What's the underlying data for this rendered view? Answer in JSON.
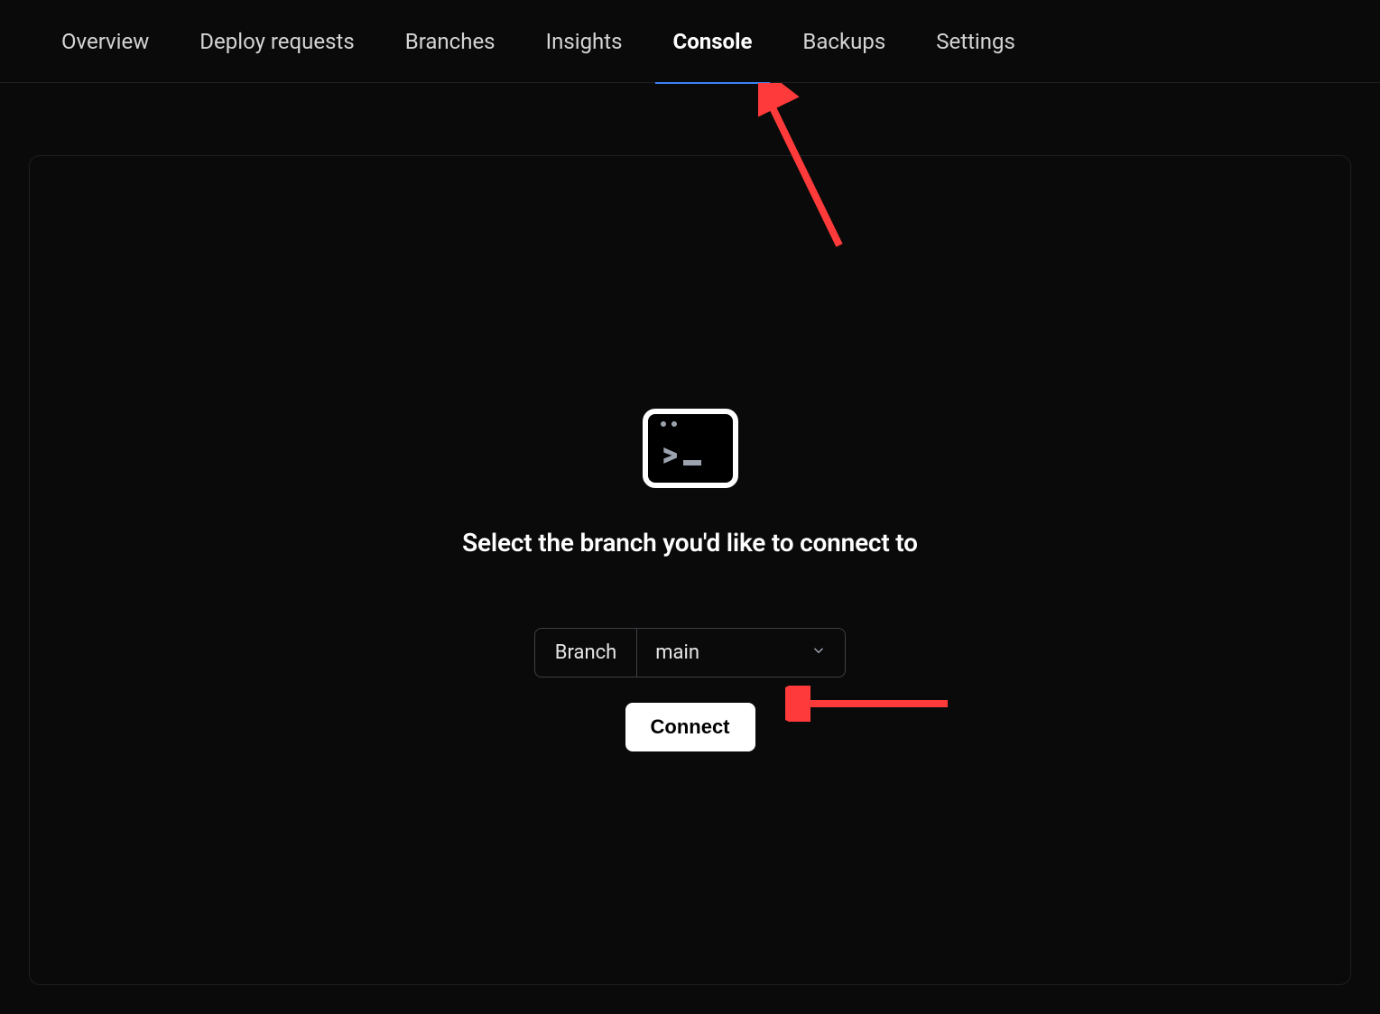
{
  "tabs": {
    "items": [
      {
        "label": "Overview",
        "active": false
      },
      {
        "label": "Deploy requests",
        "active": false
      },
      {
        "label": "Branches",
        "active": false
      },
      {
        "label": "Insights",
        "active": false
      },
      {
        "label": "Console",
        "active": true
      },
      {
        "label": "Backups",
        "active": false
      },
      {
        "label": "Settings",
        "active": false
      }
    ]
  },
  "console": {
    "heading": "Select the branch you'd like to connect to",
    "branch_label": "Branch",
    "branch_selected": "main",
    "connect_button": "Connect"
  },
  "annotations": {
    "arrow_color": "#ff3a3a"
  }
}
